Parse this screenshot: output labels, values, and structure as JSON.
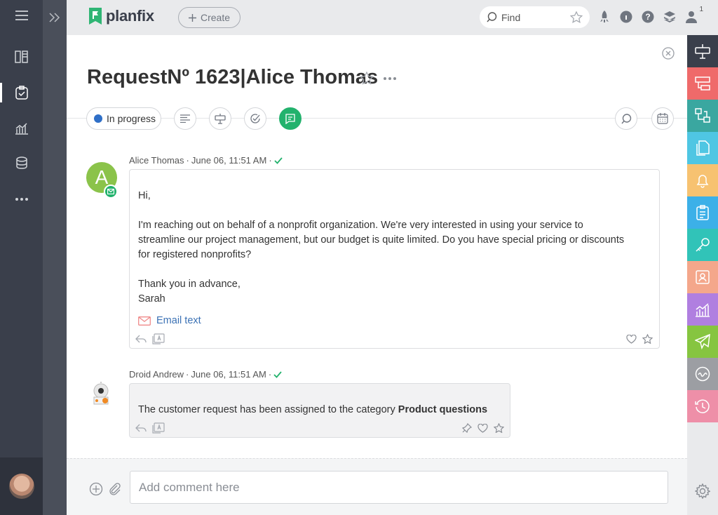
{
  "app": {
    "logo_text": "planfix"
  },
  "topbar": {
    "create_label": "Create",
    "find_placeholder": "Find",
    "notification_count": "1"
  },
  "task": {
    "title": "RequestNº 1623|Alice Thomas",
    "status_label": "In progress",
    "status_color": "#2f6fc7"
  },
  "messages": [
    {
      "author": "Alice Thomas",
      "date": "June 06, 11:51 AM",
      "avatar_letter": "A",
      "avatar_color": "#8bc34a",
      "lines": [
        "Hi,",
        "I'm reaching out on behalf of a nonprofit organization. We're very interested in using your service to streamline our project management, but our budget is quite limited. Do you have special pricing or discounts for registered nonprofits?",
        "Thank you in advance,",
        "Sarah"
      ],
      "email_link": "Email text"
    },
    {
      "author": "Droid Andrew",
      "date": "June 06, 11:51 AM",
      "text_prefix": "The customer request has been assigned to the category ",
      "text_bold": "Product questions"
    }
  ],
  "comment": {
    "placeholder": "Add comment here"
  },
  "colors": {
    "accent_green": "#23b26d",
    "rail_dark": "#3a3f4b",
    "right_rail": [
      "#3a3f4b",
      "#ef6a6a",
      "#3aa7a0",
      "#4fc6e3",
      "#f7c271",
      "#3cb0e8",
      "#31c3b8",
      "#f4a78b",
      "#b07fe0",
      "#86c540",
      "#9c9ea3",
      "#ee8fa8"
    ]
  }
}
